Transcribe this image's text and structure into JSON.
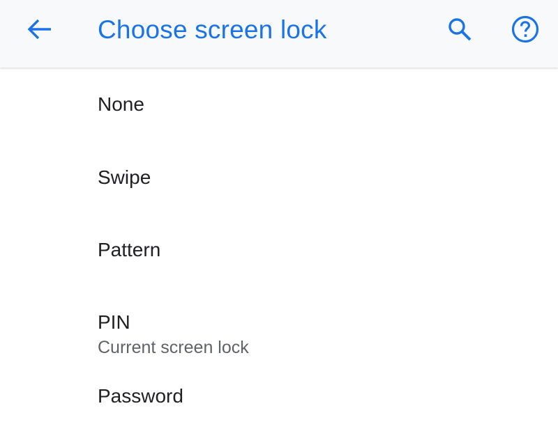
{
  "toolbar": {
    "back_icon": "arrow-back-icon",
    "title": "Choose screen lock",
    "search_icon": "search-icon",
    "help_icon": "help-circle-icon",
    "accent_color": "#1a73e8"
  },
  "options": [
    {
      "title": "None"
    },
    {
      "title": "Swipe"
    },
    {
      "title": "Pattern"
    },
    {
      "title": "PIN",
      "summary": "Current screen lock"
    },
    {
      "title": "Password"
    }
  ]
}
